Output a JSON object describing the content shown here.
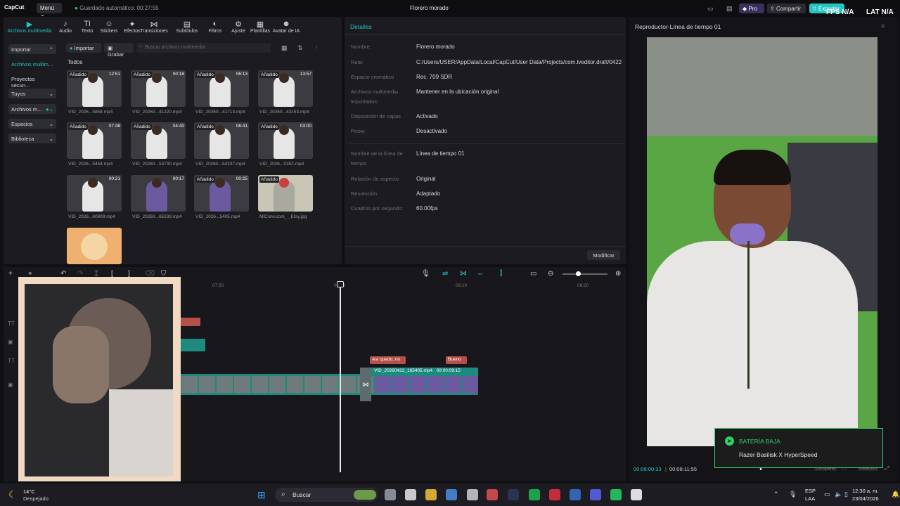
{
  "titlebar": {
    "logo": "CapCut",
    "menu": "Menú",
    "autosave": "Guardado automático: 00:27:55",
    "project_title": "Florero morado",
    "pro": "Pro",
    "share": "Compartir",
    "export": "Exportar",
    "fps": "FPS N/A",
    "lat": "LAT N/A"
  },
  "toolbar": {
    "items": [
      {
        "label": "Archivos multimedia",
        "icon": "media-icon"
      },
      {
        "label": "Audio",
        "icon": "audio-icon"
      },
      {
        "label": "Texto",
        "icon": "text-icon"
      },
      {
        "label": "Stickers",
        "icon": "sticker-icon"
      },
      {
        "label": "Efectos",
        "icon": "effects-icon"
      },
      {
        "label": "Transiciones",
        "icon": "transition-icon"
      },
      {
        "label": "Subtítulos",
        "icon": "captions-icon"
      },
      {
        "label": "Filtros",
        "icon": "filter-icon"
      },
      {
        "label": "Ajuste",
        "icon": "adjust-icon"
      },
      {
        "label": "Plantillas",
        "icon": "templates-icon"
      },
      {
        "label": "Avatar de IA",
        "icon": "avatar-icon"
      }
    ]
  },
  "sidebar": {
    "items": [
      {
        "label": "Importar"
      },
      {
        "label": "Archivos multim..."
      },
      {
        "label": "Proyectos secun..."
      },
      {
        "label": "Tuyos"
      },
      {
        "label": "Archivos m..."
      },
      {
        "label": "Espacios"
      },
      {
        "label": "Biblioteca"
      }
    ]
  },
  "media": {
    "import_btn": "Importar",
    "record_btn": "Grabar",
    "search_placeholder": "Buscar archivos multimedia",
    "section": "Todos",
    "added_tag": "Añadido",
    "items": [
      {
        "name": "VID_2026...5858.mp4",
        "dur": "12:51"
      },
      {
        "name": "VID_20260...41220.mp4",
        "dur": "00:18"
      },
      {
        "name": "VID_20260...41713.mp4",
        "dur": "06:13"
      },
      {
        "name": "VID_20260...43153.mp4",
        "dur": "13:57"
      },
      {
        "name": "VID_2026...5454.mp4",
        "dur": "07:48"
      },
      {
        "name": "VID_20260...53730.mp4",
        "dur": "04:40"
      },
      {
        "name": "VID_20260...54337.mp4",
        "dur": "06:41"
      },
      {
        "name": "VID_2026...0352.mp4",
        "dur": "03:00"
      },
      {
        "name": "VID_2026...60909.mp4",
        "dur": "00:21"
      },
      {
        "name": "VID_20260...65339.mp4",
        "dur": "00:17"
      },
      {
        "name": "VID_2026...5405.mp4",
        "dur": "00:25"
      },
      {
        "name": "MiConv.com_ _Etsy.jpg",
        "dur": ""
      }
    ]
  },
  "details": {
    "title": "Detalles",
    "rows": [
      {
        "label": "Nombre:",
        "value": "Florero morado"
      },
      {
        "label": "Ruta:",
        "value": "C:/Users/USER/AppData/Local/CapCut/User Data/Projects/com.lveditor.draft/0422"
      },
      {
        "label": "Espacio cromático",
        "value": "Rec. 709 SDR"
      },
      {
        "label": "Archivos multimedia importados:",
        "value": "Mantener en la ubicación original"
      },
      {
        "label": "Disposición de capas",
        "value": "Activado"
      },
      {
        "label": "Proxy:",
        "value": "Desactivado"
      },
      {
        "label": "Nombre de la línea de tiempo",
        "value": "Línea de tiempo 01"
      },
      {
        "label": "Relación de aspecto:",
        "value": "Original"
      },
      {
        "label": "Resolución:",
        "value": "Adaptado"
      },
      {
        "label": "Cuadros por segundo:",
        "value": "60.00fps"
      }
    ],
    "modify_btn": "Modificar"
  },
  "timeline": {
    "ticks": [
      "07:50",
      "08:00",
      "08:10",
      "08:20"
    ],
    "clip_name": "VID_20260422_165405.mp4",
    "clip_dur": "00:00:09:15",
    "text_clip_1": "Así quedo, no",
    "text_clip_2": "Bueno"
  },
  "player": {
    "title": "Reproductor-Línea de tiempo 01",
    "current_time": "00:08:00:33",
    "total_time": "00:08:11:55",
    "compare": "Comparar",
    "ratio": "Relación"
  },
  "toast": {
    "title": "BATERÍA BAJA",
    "message": "Razer Basilisk X HyperSpeed"
  },
  "taskbar": {
    "weather_temp": "14°C",
    "weather_desc": "Despejado",
    "search": "Buscar",
    "lang": "ESP",
    "lang2": "LAA",
    "time": "12:30 a. m.",
    "date": "23/04/2026"
  },
  "colors": {
    "accent": "#23c4c6",
    "clip_green": "#1e8a7f",
    "text_clip": "#b5504a",
    "toast_border": "#2fd06a"
  }
}
